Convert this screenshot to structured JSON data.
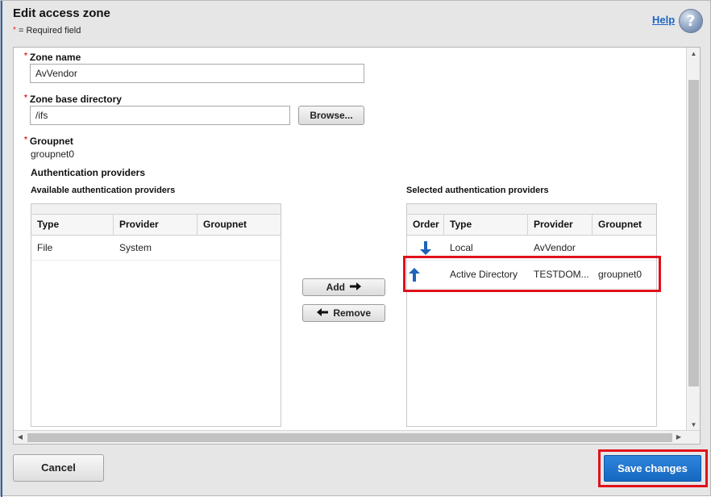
{
  "dialog": {
    "title": "Edit access zone",
    "required_star": "*",
    "required_note": "= Required field",
    "help_label": "Help",
    "help_icon_glyph": "?"
  },
  "form": {
    "zone_name": {
      "star": "*",
      "label": "Zone name",
      "value": "AvVendor"
    },
    "zone_base_directory": {
      "star": "*",
      "label": "Zone base directory",
      "value": "/ifs",
      "browse_label": "Browse..."
    },
    "groupnet": {
      "star": "*",
      "label": "Groupnet",
      "value": "groupnet0"
    },
    "auth_providers_heading": "Authentication providers"
  },
  "available": {
    "label": "Available authentication providers",
    "columns": [
      "Type",
      "Provider",
      "Groupnet"
    ],
    "rows": [
      {
        "type": "File",
        "provider": "System",
        "groupnet": ""
      }
    ]
  },
  "actions": {
    "add_label": "Add",
    "remove_label": "Remove"
  },
  "selected": {
    "label": "Selected authentication providers",
    "columns": [
      "Order",
      "Type",
      "Provider",
      "Groupnet"
    ],
    "rows": [
      {
        "order_icon": "arrow-down-icon",
        "type": "Local",
        "provider": "AvVendor",
        "groupnet": ""
      },
      {
        "order_icon": "arrow-up-icon",
        "type": "Active Directory",
        "provider": "TESTDOM...",
        "groupnet": "groupnet0"
      }
    ]
  },
  "footer": {
    "cancel_label": "Cancel",
    "save_label": "Save changes"
  },
  "colors": {
    "accent": "#1f66c4",
    "save_button": "#1e72cc",
    "highlight": "#e0111b",
    "required_star": "#dd2222"
  }
}
